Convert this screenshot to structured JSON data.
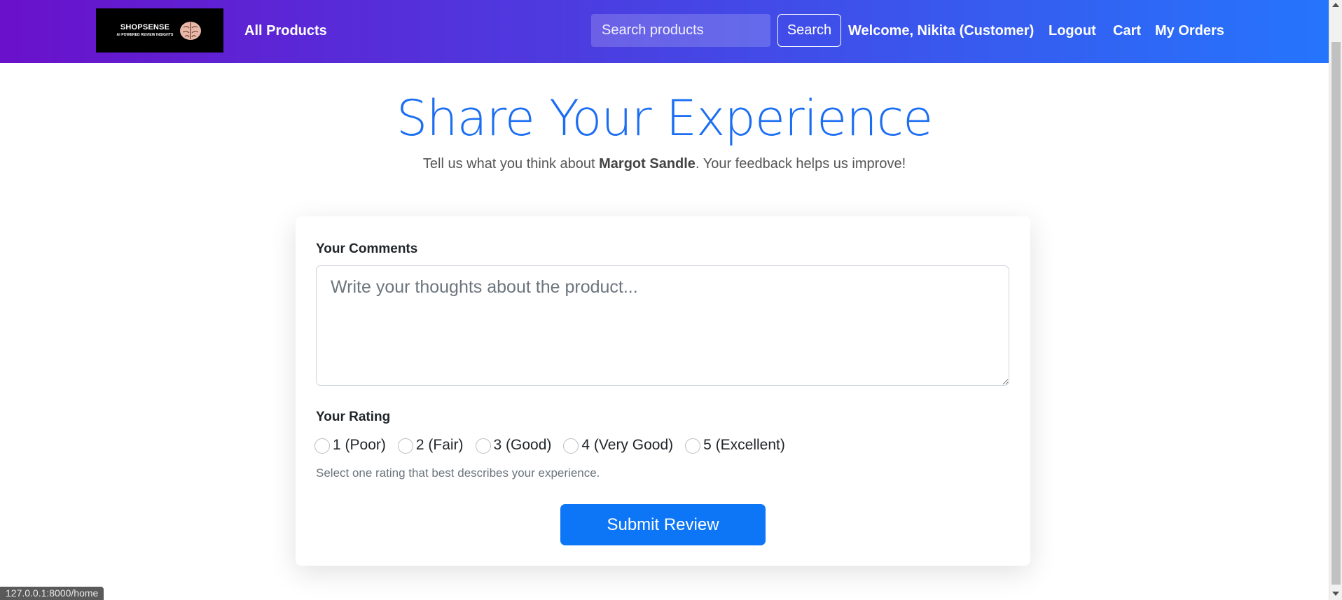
{
  "navbar": {
    "logo_title": "SHOPSENSE",
    "logo_subtitle": "AI POWERED REVIEW INSIGHTS",
    "all_products": "All Products",
    "search_placeholder": "Search products",
    "search_button": "Search",
    "welcome": "Welcome, Nikita (Customer)",
    "logout": "Logout",
    "cart": "Cart",
    "my_orders": "My Orders"
  },
  "header": {
    "title": "Share Your Experience",
    "subtitle_prefix": "Tell us what you think about ",
    "product_name": "Margot Sandle",
    "subtitle_suffix": ". Your feedback helps us improve!"
  },
  "form": {
    "comments_label": "Your Comments",
    "comments_placeholder": "Write your thoughts about the product...",
    "rating_label": "Your Rating",
    "rating_options": [
      "1 (Poor)",
      "2 (Fair)",
      "3 (Good)",
      "4 (Very Good)",
      "5 (Excellent)"
    ],
    "rating_help": "Select one rating that best describes your experience.",
    "submit_label": "Submit Review"
  },
  "statusbar": {
    "url": "127.0.0.1:8000/home"
  },
  "colors": {
    "gradient_start": "#6a11cb",
    "gradient_end": "#2575fc",
    "title": "#1b6ef3",
    "submit": "#0d76f6"
  }
}
